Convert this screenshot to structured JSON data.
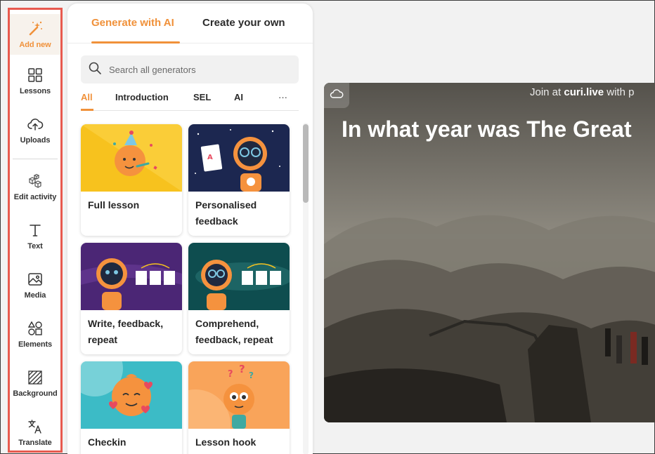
{
  "sidebar": {
    "items": [
      {
        "label": "Add new",
        "icon": "magic-wand-icon"
      },
      {
        "label": "Lessons",
        "icon": "grid-icon"
      },
      {
        "label": "Uploads",
        "icon": "cloud-upload-icon"
      },
      {
        "label": "Edit activity",
        "icon": "blocks-icon"
      },
      {
        "label": "Text",
        "icon": "text-icon"
      },
      {
        "label": "Media",
        "icon": "image-icon"
      },
      {
        "label": "Elements",
        "icon": "shapes-icon"
      },
      {
        "label": "Background",
        "icon": "hatch-icon"
      },
      {
        "label": "Translate",
        "icon": "translate-icon"
      }
    ]
  },
  "panel": {
    "tabs": [
      {
        "label": "Generate with AI"
      },
      {
        "label": "Create your own"
      }
    ],
    "search": {
      "placeholder": "Search all generators"
    },
    "filters": [
      {
        "label": "All"
      },
      {
        "label": "Introduction"
      },
      {
        "label": "SEL"
      },
      {
        "label": "AI"
      },
      {
        "label": "···"
      }
    ],
    "cards": [
      {
        "title": "Full lesson"
      },
      {
        "title": "Personalised feedback"
      },
      {
        "title": "Write, feedback, repeat"
      },
      {
        "title": "Comprehend, feedback, repeat"
      },
      {
        "title": "Checkin"
      },
      {
        "title": "Lesson hook"
      }
    ]
  },
  "slide": {
    "join_prefix": "Join at ",
    "join_site": "curi.live",
    "join_suffix": " with p",
    "question": "In what year was The Great"
  },
  "colors": {
    "accent": "#f0913a",
    "highlight_border": "#e85a4f"
  }
}
